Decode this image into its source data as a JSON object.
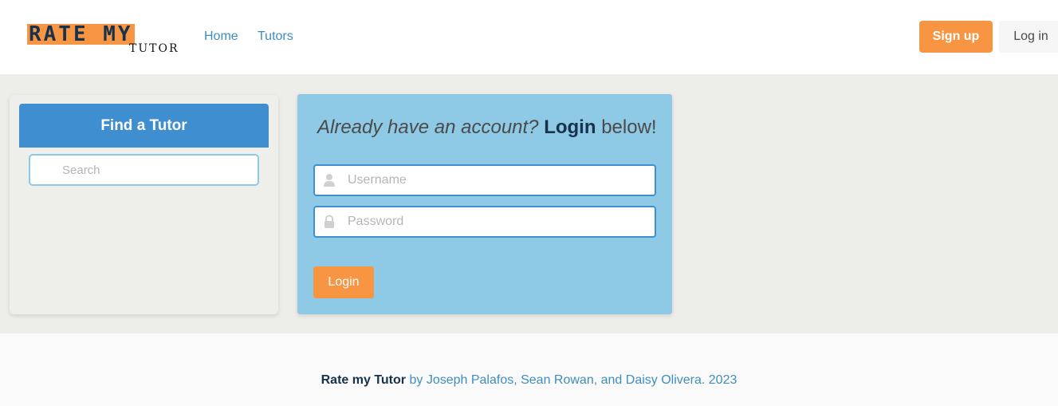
{
  "nav": {
    "logo_top": "RATE MY",
    "logo_bottom": "TUTOR",
    "links": [
      "Home",
      "Tutors"
    ],
    "signup_label": "Sign up",
    "login_label": "Log in"
  },
  "find": {
    "title": "Find a Tutor",
    "search_placeholder": "Search"
  },
  "login": {
    "heading_question": "Already have an account?",
    "heading_strong": "Login",
    "heading_tail": "below!",
    "username_placeholder": "Username",
    "password_placeholder": "Password",
    "button_label": "Login",
    "icons": [
      "user-icon",
      "lock-icon"
    ]
  },
  "footer": {
    "brand": "Rate my Tutor",
    "credits": "by Joseph Palafos, Sean Rowan, and Daisy Olivera. 2023"
  },
  "colors": {
    "accent_orange": "#f89543",
    "primary_blue": "#3e8ed0",
    "light_blue": "#8ec9e6",
    "link_blue": "#3f8dbf",
    "dark_navy": "#17324d"
  }
}
